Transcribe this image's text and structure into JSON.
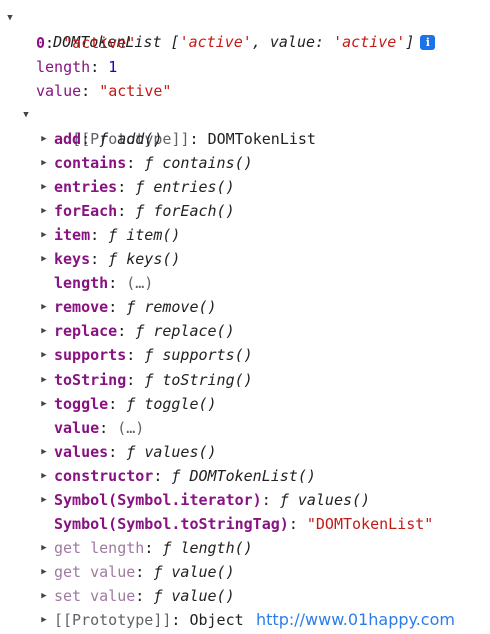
{
  "header": {
    "type": "DOMTokenList",
    "open_bracket": " [",
    "item0": "'active'",
    "sep": ", ",
    "value_key": "value",
    "colon": ": ",
    "value": "'active'",
    "close_bracket": "]",
    "info_icon": "i"
  },
  "own_props": [
    {
      "key": "0",
      "colon": ": ",
      "value": "\"active\"",
      "value_kind": "string"
    },
    {
      "key": "length",
      "colon": ": ",
      "value": "1",
      "value_kind": "number"
    },
    {
      "key": "value",
      "colon": ": ",
      "value": "\"active\"",
      "value_kind": "string"
    }
  ],
  "prototype": {
    "key": "[[Prototype]]",
    "colon": ": ",
    "value": "DOMTokenList"
  },
  "proto_members": [
    {
      "key": "add",
      "colon": ": ",
      "fsym": "ƒ ",
      "value": "add()",
      "expandable": true
    },
    {
      "key": "contains",
      "colon": ": ",
      "fsym": "ƒ ",
      "value": "contains()",
      "expandable": true
    },
    {
      "key": "entries",
      "colon": ": ",
      "fsym": "ƒ ",
      "value": "entries()",
      "expandable": true
    },
    {
      "key": "forEach",
      "colon": ": ",
      "fsym": "ƒ ",
      "value": "forEach()",
      "expandable": true
    },
    {
      "key": "item",
      "colon": ": ",
      "fsym": "ƒ ",
      "value": "item()",
      "expandable": true
    },
    {
      "key": "keys",
      "colon": ": ",
      "fsym": "ƒ ",
      "value": "keys()",
      "expandable": true
    },
    {
      "key": "length",
      "colon": ": ",
      "fsym": "",
      "value": "(…)",
      "expandable": false
    },
    {
      "key": "remove",
      "colon": ": ",
      "fsym": "ƒ ",
      "value": "remove()",
      "expandable": true
    },
    {
      "key": "replace",
      "colon": ": ",
      "fsym": "ƒ ",
      "value": "replace()",
      "expandable": true
    },
    {
      "key": "supports",
      "colon": ": ",
      "fsym": "ƒ ",
      "value": "supports()",
      "expandable": true
    },
    {
      "key": "toString",
      "colon": ": ",
      "fsym": "ƒ ",
      "value": "toString()",
      "expandable": true
    },
    {
      "key": "toggle",
      "colon": ": ",
      "fsym": "ƒ ",
      "value": "toggle()",
      "expandable": true
    },
    {
      "key": "value",
      "colon": ": ",
      "fsym": "",
      "value": "(…)",
      "expandable": false
    },
    {
      "key": "values",
      "colon": ": ",
      "fsym": "ƒ ",
      "value": "values()",
      "expandable": true
    },
    {
      "key": "constructor",
      "colon": ": ",
      "fsym": "ƒ ",
      "value": "DOMTokenList()",
      "expandable": true
    },
    {
      "key": "Symbol(Symbol.iterator)",
      "colon": ": ",
      "fsym": "ƒ ",
      "value": "values()",
      "expandable": true
    },
    {
      "key": "Symbol(Symbol.toStringTag)",
      "colon": ": ",
      "fsym": "",
      "value": "\"DOMTokenList\"",
      "expandable": false,
      "value_kind": "string"
    },
    {
      "key": "get length",
      "colon": ": ",
      "fsym": "ƒ ",
      "value": "length()",
      "expandable": true,
      "dim": true
    },
    {
      "key": "get value",
      "colon": ": ",
      "fsym": "ƒ ",
      "value": "value()",
      "expandable": true,
      "dim": true
    },
    {
      "key": "set value",
      "colon": ": ",
      "fsym": "ƒ ",
      "value": "value()",
      "expandable": true,
      "dim": true
    },
    {
      "key": "[[Prototype]]",
      "colon": ": ",
      "fsym": "",
      "value": "Object",
      "expandable": true,
      "proto": true
    }
  ],
  "watermark": "http://www.01happy.com",
  "colors": {
    "key": "#881280",
    "string": "#c41a16",
    "number": "#1c00cf",
    "info_icon_bg": "#1a73e8",
    "watermark": "#2b7de9"
  },
  "icons": {
    "expanded": "triangle-down-icon",
    "collapsed": "triangle-right-icon",
    "info": "info-icon"
  }
}
